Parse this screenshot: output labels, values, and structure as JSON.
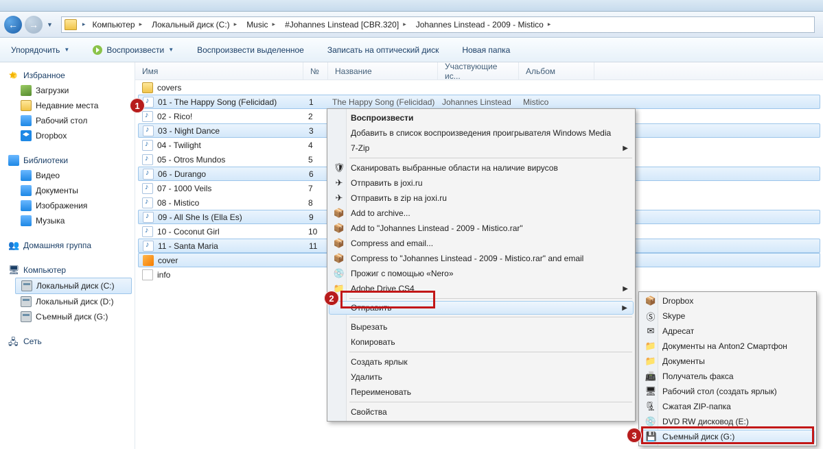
{
  "breadcrumb": [
    {
      "label": "Компьютер"
    },
    {
      "label": "Локальный диск (C:)"
    },
    {
      "label": "Music"
    },
    {
      "label": "#Johannes Linstead [CBR.320]"
    },
    {
      "label": "Johannes Linstead - 2009 - Mistico"
    }
  ],
  "toolbar": {
    "organize": "Упорядочить",
    "play": "Воспроизвести",
    "playSel": "Воспроизвести выделенное",
    "burn": "Записать на оптический диск",
    "newFolder": "Новая папка"
  },
  "sidebar": {
    "favorites": "Избранное",
    "downloads": "Загрузки",
    "recent": "Недавние места",
    "desktop": "Рабочий стол",
    "dropbox": "Dropbox",
    "libraries": "Библиотеки",
    "video": "Видео",
    "documents": "Документы",
    "pictures": "Изображения",
    "music": "Музыка",
    "homegroup": "Домашняя группа",
    "computer": "Компьютер",
    "diskC": "Локальный диск (C:)",
    "diskD": "Локальный диск (D:)",
    "diskG": "Съемный диск (G:)",
    "network": "Сеть"
  },
  "columns": {
    "name": "Имя",
    "num": "№",
    "title": "Название",
    "artist": "Участвующие ис...",
    "album": "Альбом"
  },
  "files": [
    {
      "type": "folder",
      "name": "covers",
      "sel": false
    },
    {
      "type": "music",
      "name": "01 - The Happy Song (Felicidad)",
      "num": "1",
      "title": "The Happy Song (Felicidad)",
      "artist": "Johannes Linstead",
      "album": "Mistico",
      "sel": true,
      "showMeta": true
    },
    {
      "type": "music",
      "name": "02 - Rico!",
      "num": "2",
      "sel": false
    },
    {
      "type": "music",
      "name": "03 - Night Dance",
      "num": "3",
      "sel": true
    },
    {
      "type": "music",
      "name": "04 - Twilight",
      "num": "4",
      "sel": false
    },
    {
      "type": "music",
      "name": "05 - Otros Mundos",
      "num": "5",
      "sel": false
    },
    {
      "type": "music",
      "name": "06 - Durango",
      "num": "6",
      "sel": true
    },
    {
      "type": "music",
      "name": "07 - 1000 Veils",
      "num": "7",
      "sel": false
    },
    {
      "type": "music",
      "name": "08 - Mistico",
      "num": "8",
      "sel": false
    },
    {
      "type": "music",
      "name": "09 - All She Is (Ella Es)",
      "num": "9",
      "sel": true
    },
    {
      "type": "music",
      "name": "10 - Coconut Girl",
      "num": "10",
      "sel": false
    },
    {
      "type": "music",
      "name": "11 - Santa Maria",
      "num": "11",
      "sel": true
    },
    {
      "type": "jpg",
      "name": "cover",
      "sel": true
    },
    {
      "type": "txt",
      "name": "info",
      "sel": false
    }
  ],
  "ctxMain": [
    {
      "label": "Воспроизвести",
      "bold": true
    },
    {
      "label": "Добавить в список воспроизведения проигрывателя Windows Media"
    },
    {
      "label": "7-Zip",
      "sub": true
    },
    {
      "sep": true
    },
    {
      "label": "Сканировать выбранные области на наличие вирусов",
      "icon": "🛡"
    },
    {
      "label": "Отправить в joxi.ru",
      "icon": "✈"
    },
    {
      "label": "Отправить в zip на joxi.ru",
      "icon": "✈"
    },
    {
      "label": "Add to archive...",
      "icon": "📦"
    },
    {
      "label": "Add to \"Johannes Linstead - 2009 - Mistico.rar\"",
      "icon": "📦"
    },
    {
      "label": "Compress and email...",
      "icon": "📦"
    },
    {
      "label": "Compress to \"Johannes Linstead - 2009 - Mistico.rar\" and email",
      "icon": "📦"
    },
    {
      "label": "Прожиг с помощью «Nero»",
      "icon": "💿"
    },
    {
      "label": "Adobe Drive CS4",
      "icon": "📁",
      "sub": true
    },
    {
      "sep": true
    },
    {
      "label": "Отправить",
      "sub": true,
      "hl": true,
      "redbox": true
    },
    {
      "sep": true
    },
    {
      "label": "Вырезать"
    },
    {
      "label": "Копировать"
    },
    {
      "sep": true
    },
    {
      "label": "Создать ярлык"
    },
    {
      "label": "Удалить"
    },
    {
      "label": "Переименовать"
    },
    {
      "sep": true
    },
    {
      "label": "Свойства"
    }
  ],
  "ctxSub": [
    {
      "label": "Dropbox",
      "icon": "drop"
    },
    {
      "label": "Skype",
      "icon": "skype"
    },
    {
      "label": "Адресат",
      "icon": "mail"
    },
    {
      "label": "Документы на Anton2 Смартфон",
      "icon": "fold"
    },
    {
      "label": "Документы",
      "icon": "fold"
    },
    {
      "label": "Получатель факса",
      "icon": "fax"
    },
    {
      "label": "Рабочий стол (создать ярлык)",
      "icon": "desk"
    },
    {
      "label": "Сжатая ZIP-папка",
      "icon": "zip"
    },
    {
      "label": "DVD RW дисковод (E:)",
      "icon": "dvd"
    },
    {
      "label": "Съемный диск (G:)",
      "icon": "usb",
      "hl": true,
      "redbox": true
    }
  ],
  "callouts": {
    "c1": "1",
    "c2": "2",
    "c3": "3"
  }
}
